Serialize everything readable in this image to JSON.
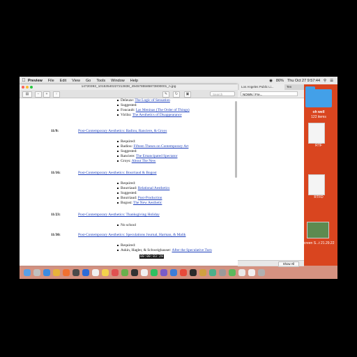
{
  "menubar": {
    "app_name": "Preview",
    "items": [
      "File",
      "Edit",
      "View",
      "Go",
      "Tools",
      "Window",
      "Help"
    ],
    "clock": "Thu Oct 27  9:57:44",
    "battery": "86%"
  },
  "preview": {
    "title": "14720393_10153540227213838_4945785585873800001_n.jpg",
    "search_placeholder": "Search"
  },
  "document": {
    "top_lines": [
      {
        "label": "Deleuze:",
        "link": "The Logic of Sensation"
      },
      {
        "label": "Suggested:",
        "link": ""
      },
      {
        "label": "Foucault:",
        "link": "Las Meninas (The Order of Things)"
      },
      {
        "label": "Virilio:",
        "link": "The Aesthetics of Disappearance"
      }
    ],
    "sessions": [
      {
        "date": "11/9:",
        "heading": "Post-Contemporary Aesthetics: Badiou, Ranciere, & Groys",
        "items": [
          {
            "label": "Required:",
            "link": ""
          },
          {
            "label": "Badiou:",
            "link": "Fifteen Theses on Contemporary Art"
          },
          {
            "label": "Suggested:",
            "link": ""
          },
          {
            "label": "Ranciere:",
            "link": "The Emancipated Spectator"
          },
          {
            "label": "Groys:",
            "link": "About The New"
          }
        ]
      },
      {
        "date": "11/16:",
        "heading": "Post-Contemporary Aesthetics: Bourriaud & Bogost",
        "items": [
          {
            "label": "Required:",
            "link": ""
          },
          {
            "label": "Bourriaud:",
            "link": "Relational Aesthetics"
          },
          {
            "label": "Suggested:",
            "link": ""
          },
          {
            "label": "Bourriaud:",
            "link": "Post-Production"
          },
          {
            "label": "Bogost:",
            "link": "The New Aesthetic"
          }
        ]
      },
      {
        "date": "11/23:",
        "heading": "Post-Contemporary Aesthetics: Thanksgiving Holiday",
        "items": [
          {
            "label": "No school",
            "link": ""
          }
        ]
      },
      {
        "date": "11/30:",
        "heading": "Post-Contemporary Aesthetics: Speculations Journal, Harman, & Malik",
        "items": [
          {
            "label": "Required:",
            "link": ""
          },
          {
            "label": "Askin, Hagler, & Schweighauser:",
            "link": "After the Speculative Turn"
          }
        ]
      }
    ],
    "timecode": "00:00:03:29"
  },
  "browser": {
    "tab1": "Los Angeles Public Li...",
    "tab2": "Ten",
    "address": "NOWN | Fre...",
    "download_button": "Show All"
  },
  "desktop": {
    "folder_label": "oh well",
    "folder_count": "122 items",
    "file1_label": "RTF",
    "file2_label": "RTFD",
    "file3_label": "Screen S...t 21.29.22"
  },
  "colors": {
    "desktop_bg": "#d9451f",
    "link": "#1a3dbb",
    "folder": "#43a0e8"
  }
}
